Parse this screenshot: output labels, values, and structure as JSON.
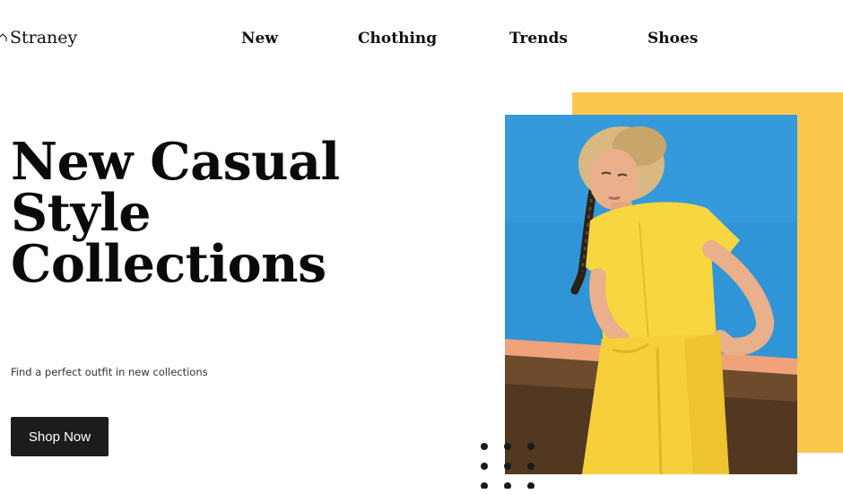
{
  "brand": {
    "name": "Straney",
    "logo_icon": "house-outline-icon"
  },
  "nav": {
    "items": [
      {
        "label": "New"
      },
      {
        "label": "Chothing"
      },
      {
        "label": "Trends"
      },
      {
        "label": "Shoes"
      }
    ]
  },
  "hero": {
    "title_lines": [
      "New Casual",
      "Style",
      "Collections"
    ],
    "subtitle": "Find a perfect outfit in new collections",
    "cta_label": "Shop Now"
  },
  "visuals": {
    "photo_description_icon": "model-photo",
    "decoration_icon": "dot-grid-icon"
  },
  "colors": {
    "accent_yellow": "#fdc74f",
    "photo_sky": "#2f95d6",
    "outfit_yellow": "#f7d640",
    "button_bg": "#1c1c1c",
    "text_dark": "#111111"
  }
}
